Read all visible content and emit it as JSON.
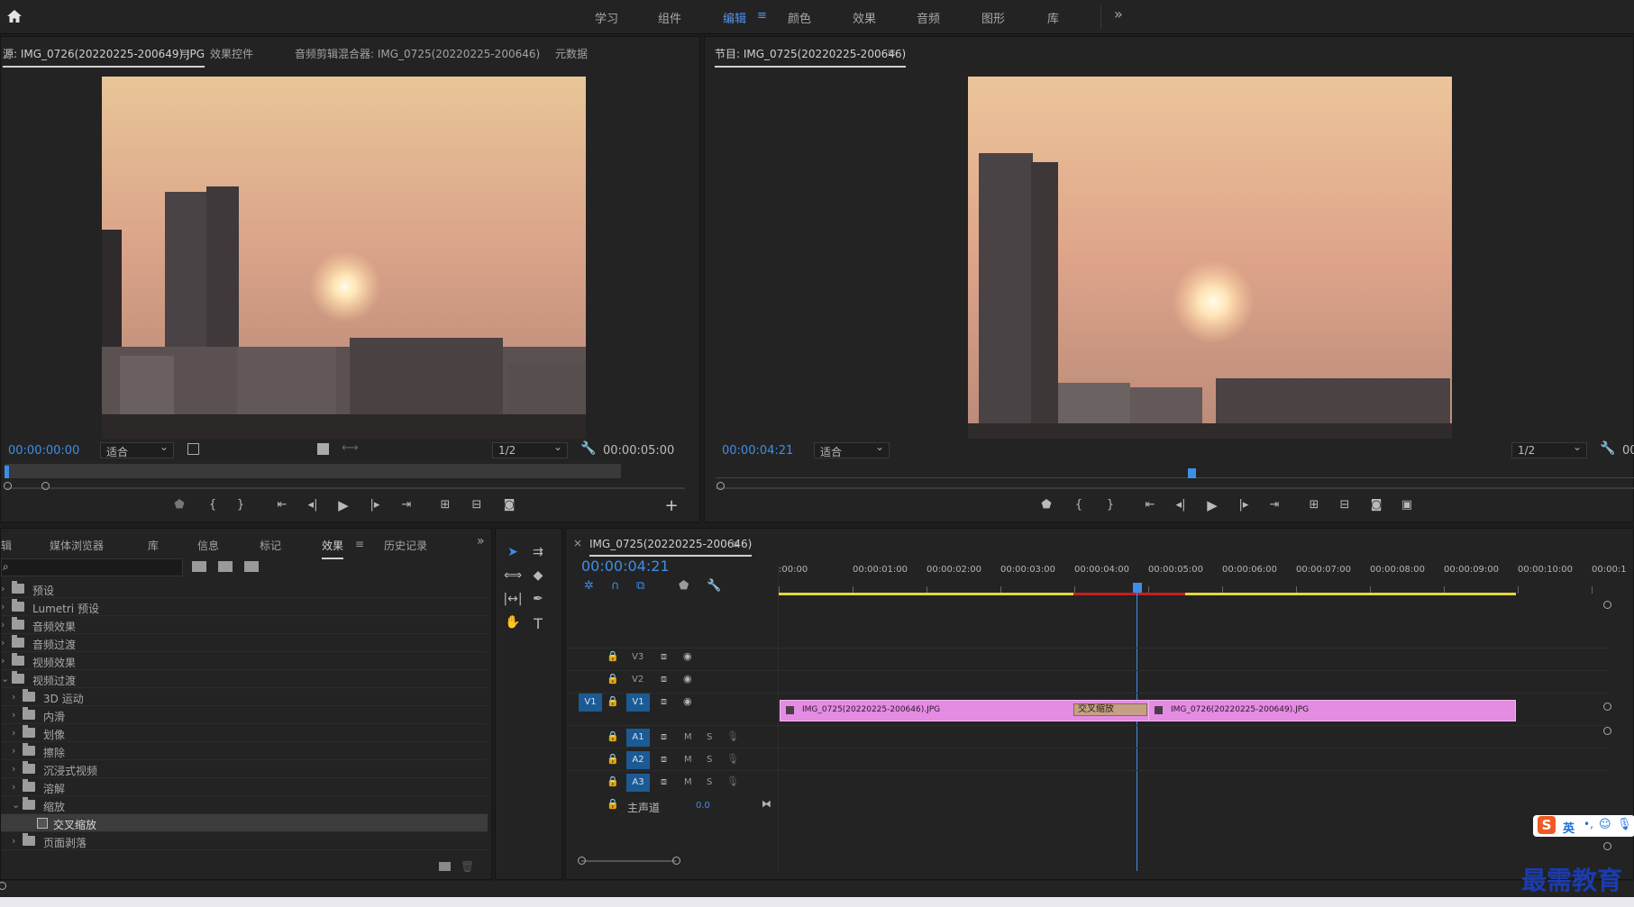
{
  "workspaces": {
    "items": [
      "学习",
      "组件",
      "编辑",
      "颜色",
      "效果",
      "音频",
      "图形",
      "库"
    ],
    "active": "编辑",
    "more": "»"
  },
  "source_panel": {
    "tab_source": "源: IMG_0726(20220225-200649).JPG",
    "tab_effect_controls": "效果控件",
    "tab_audio_mixer": "音频剪辑混合器: IMG_0725(20220225-200646)",
    "tab_metadata": "元数据",
    "timecode": "00:00:00:00",
    "fit": "适合",
    "quality": "1/2",
    "duration": "00:00:05:00",
    "plus": "+"
  },
  "program_panel": {
    "title": "节目: IMG_0725(20220225-200646)",
    "timecode": "00:00:04:21",
    "fit": "适合",
    "quality": "1/2",
    "duration_partial": "00"
  },
  "project_panel": {
    "tabs": [
      "辑",
      "媒体浏览器",
      "库",
      "信息",
      "标记",
      "效果",
      "历史记录"
    ],
    "active": "效果",
    "more": "»",
    "search_placeholder": "",
    "tree": [
      {
        "label": "预设",
        "indent": 0,
        "expanded": false,
        "type": "folder"
      },
      {
        "label": "Lumetri 预设",
        "indent": 0,
        "expanded": false,
        "type": "folder"
      },
      {
        "label": "音频效果",
        "indent": 0,
        "expanded": false,
        "type": "folder"
      },
      {
        "label": "音频过渡",
        "indent": 0,
        "expanded": false,
        "type": "folder"
      },
      {
        "label": "视频效果",
        "indent": 0,
        "expanded": false,
        "type": "folder"
      },
      {
        "label": "视频过渡",
        "indent": 0,
        "expanded": true,
        "type": "folder"
      },
      {
        "label": "3D 运动",
        "indent": 1,
        "expanded": false,
        "type": "folder"
      },
      {
        "label": "内滑",
        "indent": 1,
        "expanded": false,
        "type": "folder"
      },
      {
        "label": "划像",
        "indent": 1,
        "expanded": false,
        "type": "folder"
      },
      {
        "label": "擦除",
        "indent": 1,
        "expanded": false,
        "type": "folder"
      },
      {
        "label": "沉浸式视频",
        "indent": 1,
        "expanded": false,
        "type": "folder"
      },
      {
        "label": "溶解",
        "indent": 1,
        "expanded": false,
        "type": "folder"
      },
      {
        "label": "缩放",
        "indent": 1,
        "expanded": true,
        "type": "folder"
      },
      {
        "label": "交叉缩放",
        "indent": 2,
        "expanded": false,
        "type": "effect",
        "selected": true
      },
      {
        "label": "页面剥落",
        "indent": 1,
        "expanded": false,
        "type": "folder"
      }
    ]
  },
  "timeline": {
    "close": "×",
    "sequence_name": "IMG_0725(20220225-200646)",
    "timecode": "00:00:04:21",
    "ruler_labels": [
      ":00:00",
      "00:00:01:00",
      "00:00:02:00",
      "00:00:03:00",
      "00:00:04:00",
      "00:00:05:00",
      "00:00:06:00",
      "00:00:07:00",
      "00:00:08:00",
      "00:00:09:00",
      "00:00:10:00",
      "00:00:1"
    ],
    "video_tracks": [
      "V3",
      "V2",
      "V1"
    ],
    "source_patch": "V1",
    "audio_tracks": [
      "A1",
      "A2",
      "A3"
    ],
    "track_buttons": {
      "mute": "M",
      "solo": "S"
    },
    "master_label": "主声道",
    "master_value": "0.0",
    "clips": [
      {
        "name": "IMG_0725(20220225-200646).JPG",
        "track": "V1"
      },
      {
        "name": "IMG_0726(20220225-200649).JPG",
        "track": "V1"
      }
    ],
    "transition_label": "交叉缩放"
  },
  "ime": {
    "logo": "S",
    "lang": "英",
    "punct": "•,"
  },
  "watermark": "最需教育",
  "colors": {
    "accent": "#3d8ee8",
    "clip": "#e48be2",
    "work_area": "#e0d83a",
    "render_red": "#c42020",
    "track_chip": "#1c5a93"
  }
}
